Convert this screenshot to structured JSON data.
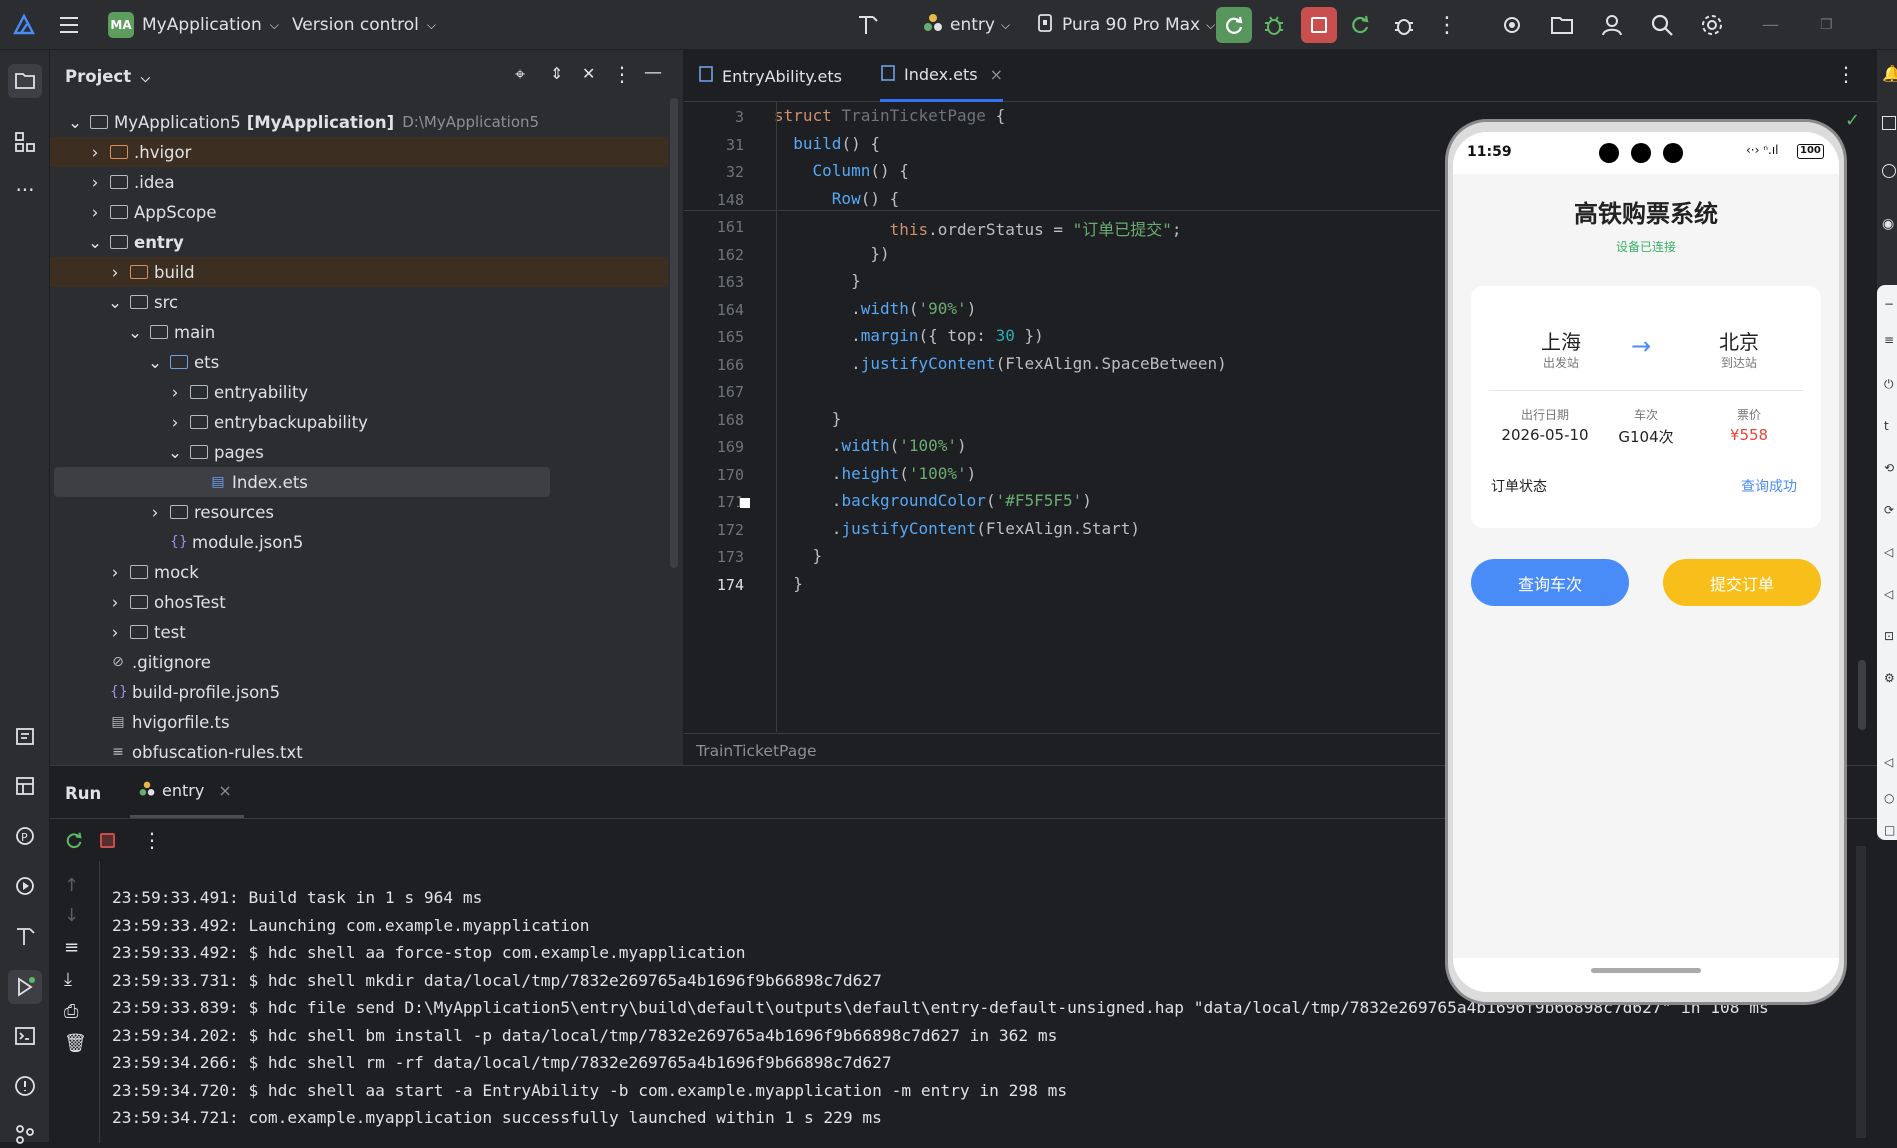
{
  "topbar": {
    "logo_initials": "MA",
    "project_name": "MyApplication",
    "vcs": "Version control",
    "run_config": "entry",
    "device": "Pura 90 Pro Max"
  },
  "project_panel": {
    "title": "Project",
    "root": {
      "name": "MyApplication5",
      "module": "[MyApplication]",
      "path": "D:\\MyApplication5"
    },
    "items": [
      {
        "label": ".hvigor",
        "kind": "folder-o"
      },
      {
        "label": ".idea",
        "kind": "folder"
      },
      {
        "label": "AppScope",
        "kind": "folder"
      },
      {
        "label": "entry",
        "kind": "folder-m"
      },
      {
        "label": "build",
        "kind": "folder-o"
      },
      {
        "label": "src",
        "kind": "folder"
      },
      {
        "label": "main",
        "kind": "folder"
      },
      {
        "label": "ets",
        "kind": "folder-b"
      },
      {
        "label": "entryability",
        "kind": "folder"
      },
      {
        "label": "entrybackupability",
        "kind": "folder"
      },
      {
        "label": "pages",
        "kind": "folder"
      },
      {
        "label": "Index.ets",
        "kind": "file-ets"
      },
      {
        "label": "resources",
        "kind": "folder"
      },
      {
        "label": "module.json5",
        "kind": "file-json"
      },
      {
        "label": "mock",
        "kind": "folder"
      },
      {
        "label": "ohosTest",
        "kind": "folder"
      },
      {
        "label": "test",
        "kind": "folder"
      },
      {
        "label": ".gitignore",
        "kind": "file-ignore"
      },
      {
        "label": "build-profile.json5",
        "kind": "file-json"
      },
      {
        "label": "hvigorfile.ts",
        "kind": "file-ts"
      },
      {
        "label": "obfuscation-rules.txt",
        "kind": "file-txt"
      }
    ]
  },
  "editor": {
    "tabs": [
      {
        "label": "EntryAbility.ets"
      },
      {
        "label": "Index.ets",
        "close": "×"
      }
    ],
    "sticky": [
      {
        "ln": "3",
        "code": "struct TrainTicketPage {"
      },
      {
        "ln": "31",
        "code": "  build() {"
      },
      {
        "ln": "32",
        "code": "    Column() {"
      },
      {
        "ln": "148",
        "code": "      Row() {"
      }
    ],
    "lines": [
      {
        "ln": "161",
        "code": "            this.orderStatus = \"订单已提交\";"
      },
      {
        "ln": "162",
        "code": "          })"
      },
      {
        "ln": "163",
        "code": "        }"
      },
      {
        "ln": "164",
        "code": "        .width('90%')"
      },
      {
        "ln": "165",
        "code": "        .margin({ top: 30 })"
      },
      {
        "ln": "166",
        "code": "        .justifyContent(FlexAlign.SpaceBetween)"
      },
      {
        "ln": "167",
        "code": ""
      },
      {
        "ln": "168",
        "code": "      }"
      },
      {
        "ln": "169",
        "code": "      .width('100%')"
      },
      {
        "ln": "170",
        "code": "      .height('100%')"
      },
      {
        "ln": "171",
        "code": "      .backgroundColor('#F5F5F5')"
      },
      {
        "ln": "172",
        "code": "      .justifyContent(FlexAlign.Start)"
      },
      {
        "ln": "173",
        "code": "    }"
      },
      {
        "ln": "174",
        "code": "  }"
      }
    ],
    "breadcrumb": "TrainTicketPage"
  },
  "run_panel": {
    "title": "Run",
    "tab": "entry",
    "close": "×",
    "logs": [
      "23:59:33.491: Build task in 1 s 964 ms",
      "23:59:33.492: Launching com.example.myapplication",
      "23:59:33.492: $ hdc shell aa force-stop com.example.myapplication",
      "23:59:33.731: $ hdc shell mkdir data/local/tmp/7832e269765a4b1696f9b66898c7d627",
      "23:59:33.839: $ hdc file send D:\\MyApplication5\\entry\\build\\default\\outputs\\default\\entry-default-unsigned.hap \"data/local/tmp/7832e269765a4b1696f9b66898c7d627\" in 108 ms",
      "23:59:34.202: $ hdc shell bm install -p data/local/tmp/7832e269765a4b1696f9b66898c7d627 in 362 ms",
      "23:59:34.266: $ hdc shell rm -rf data/local/tmp/7832e269765a4b1696f9b66898c7d627",
      "23:59:34.720: $ hdc shell aa start -a EntryAbility -b com.example.myapplication -m entry in 298 ms",
      "23:59:34.721: com.example.myapplication successfully launched within 1 s 229 ms"
    ]
  },
  "phone": {
    "time": "11:59",
    "battery": "100",
    "app": {
      "title": "高铁购票系统",
      "connection": "设备已连接",
      "from_city": "上海",
      "from_label": "出发站",
      "to_city": "北京",
      "to_label": "到达站",
      "date_label": "出行日期",
      "date": "2026-05-10",
      "train_label": "车次",
      "train": "G104次",
      "price_label": "票价",
      "price": "¥558",
      "status_label": "订单状态",
      "status": "查询成功",
      "btn_query": "查询车次",
      "btn_submit": "提交订单"
    }
  },
  "colors": {
    "accent": "#4a8cf7",
    "submit": "#f8be1a",
    "price": "#e8443a",
    "ok": "#3bb067"
  }
}
